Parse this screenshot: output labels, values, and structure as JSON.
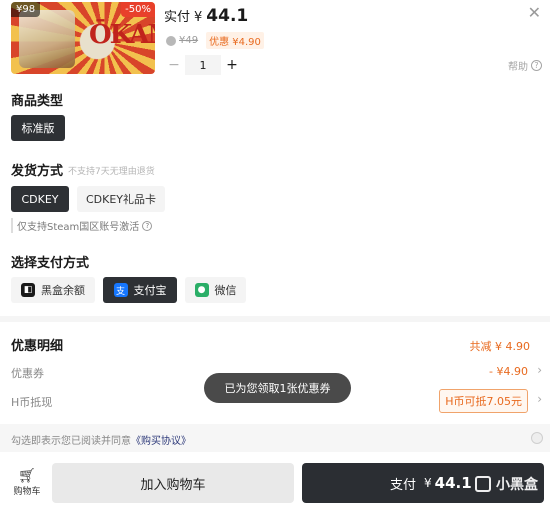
{
  "product": {
    "badge_price": "¥98",
    "discount": "-50%",
    "logo_text": "ŌKAMI",
    "price_label": "实付",
    "currency": "¥",
    "price": "44.1",
    "original_price": "¥49",
    "promo": "优惠 ¥4.90",
    "quantity": "1"
  },
  "help_label": "帮助",
  "edition": {
    "title": "商品类型",
    "options": [
      "标准版"
    ]
  },
  "delivery": {
    "title": "发货方式",
    "note": "不支持7天无理由退货",
    "options": [
      "CDKEY",
      "CDKEY礼品卡"
    ],
    "hint": "仅支持Steam国区账号激活"
  },
  "payment": {
    "title": "选择支付方式",
    "options": [
      {
        "label": "黑盒余额",
        "icon": "heihe-icon",
        "color": "#1a1a1a"
      },
      {
        "label": "支付宝",
        "icon": "alipay-icon",
        "color": "#1677ff"
      },
      {
        "label": "微信",
        "icon": "wechat-icon",
        "color": "#2aae67"
      }
    ]
  },
  "details": {
    "title": "优惠明细",
    "total": "共减 ¥ 4.90",
    "coupon_label": "优惠券",
    "coupon_value": "- ¥4.90",
    "hcoin_label": "H币抵现",
    "hcoin_value": "H币可抵7.05元"
  },
  "toast": "已为您领取1张优惠券",
  "agreement": {
    "text": "勾选即表示您已阅读并同意",
    "link": "《购买协议》"
  },
  "footer": {
    "cart_label": "购物车",
    "add_cart": "加入购物车",
    "pay_label": "支付",
    "pay_currency": "¥",
    "pay_amount": "44.1",
    "watermark": "小黑盒"
  }
}
